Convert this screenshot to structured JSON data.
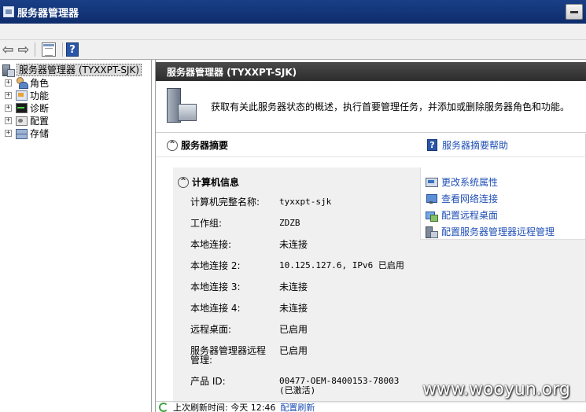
{
  "window": {
    "title": "服务器管理器"
  },
  "toolbar": {
    "help_label": "?"
  },
  "tree": {
    "root": "服务器管理器 (TYXXPT-SJK)",
    "items": [
      {
        "label": "角色",
        "icon": "roles-icon"
      },
      {
        "label": "功能",
        "icon": "features-icon"
      },
      {
        "label": "诊断",
        "icon": "diagnostics-icon"
      },
      {
        "label": "配置",
        "icon": "configuration-icon"
      },
      {
        "label": "存储",
        "icon": "storage-icon"
      }
    ],
    "expander": "+"
  },
  "main": {
    "header": "服务器管理器 (TYXXPT-SJK)",
    "intro": "获取有关此服务器状态的概述，执行首要管理任务，并添加或删除服务器角色和功能。",
    "summary": {
      "title": "服务器摘要",
      "help_link": "服务器摘要帮助",
      "collapse_symbol": "^"
    },
    "computer_info": {
      "title": "计算机信息",
      "rows": [
        {
          "label": "计算机完整名称:",
          "value": "tyxxpt-sjk"
        },
        {
          "label": "工作组:",
          "value": "ZDZB"
        },
        {
          "label": "本地连接:",
          "value": "未连接"
        },
        {
          "label": "本地连接 2:",
          "value": "10.125.127.6, IPv6 已启用"
        },
        {
          "label": "本地连接 3:",
          "value": "未连接"
        },
        {
          "label": "本地连接 4:",
          "value": "未连接"
        },
        {
          "label": "远程桌面:",
          "value": "已启用"
        },
        {
          "label": "服务器管理器远程管理:",
          "value": "已启用"
        },
        {
          "label": "产品 ID:",
          "value": "00477-OEM-8400153-78003 (已激活)"
        }
      ],
      "tasks": [
        {
          "label": "更改系统属性"
        },
        {
          "label": "查看网络连接"
        },
        {
          "label": "配置远程桌面"
        },
        {
          "label": "配置服务器管理器远程管理"
        }
      ]
    },
    "footer": {
      "last_refresh": "上次刷新时间: 今天 12:46",
      "configure_refresh": "配置刷新"
    }
  },
  "watermark": "www.wooyun.org"
}
